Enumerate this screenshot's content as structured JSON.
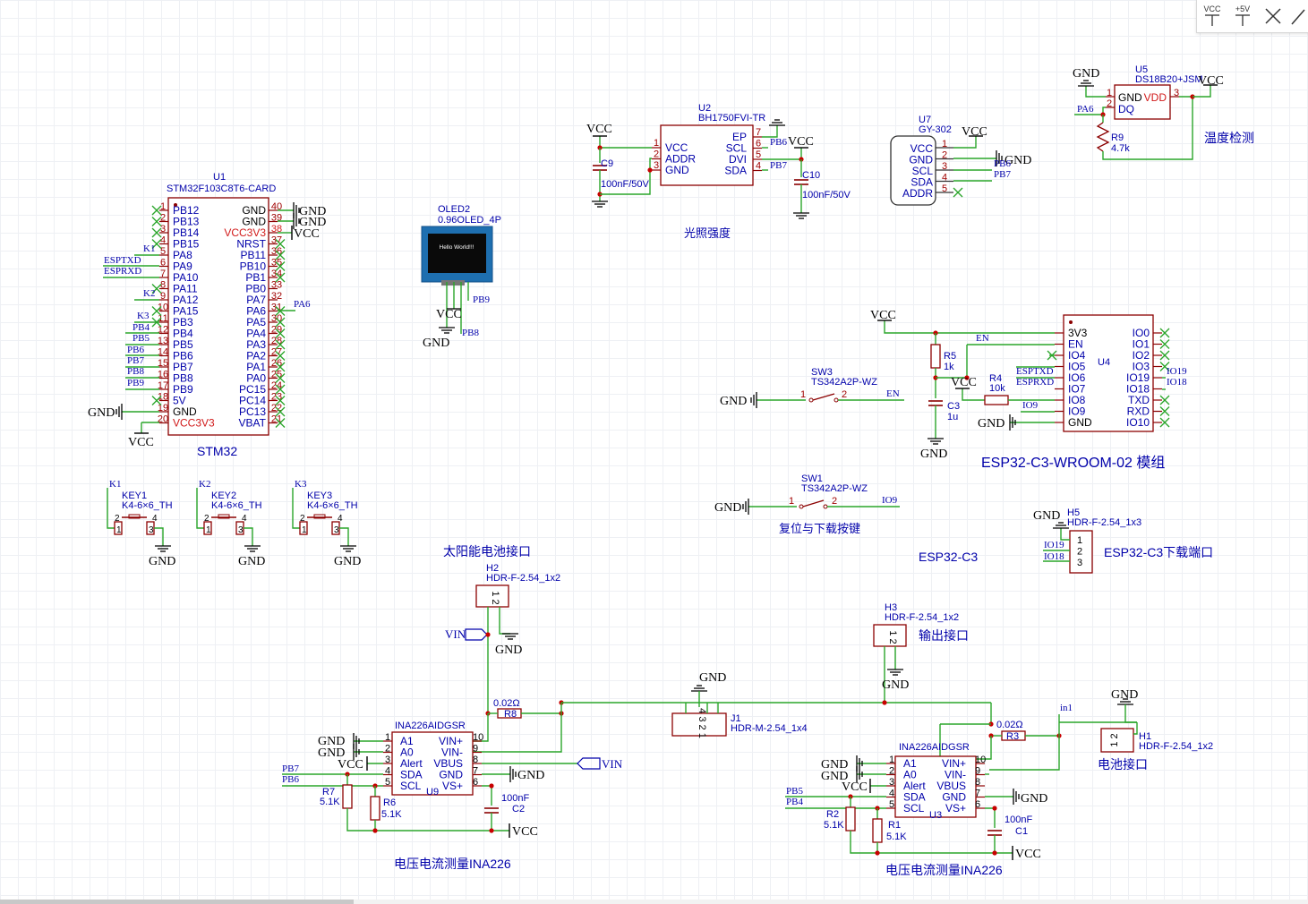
{
  "toolbar": {
    "vcc_label": "VCC",
    "plus5_label": "+5V"
  },
  "net": {
    "vcc": "VCC",
    "gnd": "GND",
    "vin": "VIN",
    "in1": "in1",
    "en": "EN",
    "io9": "IO9",
    "io18": "IO18",
    "io19": "IO19",
    "pa6": "PA6",
    "pb6": "PB6",
    "pb7": "PB7",
    "pb8": "PB8",
    "pb9": "PB9",
    "pb4": "PB4",
    "pb5": "PB5",
    "k1": "K1",
    "k2": "K2",
    "k3": "K3",
    "esptxd": "ESPTXD",
    "esprxd": "ESPRXD"
  },
  "u1": {
    "ref": "U1",
    "part": "STM32F103C8T6-CARD",
    "title": "STM32",
    "left_pins": [
      {
        "n": "1",
        "name": "PB12"
      },
      {
        "n": "2",
        "name": "PB13"
      },
      {
        "n": "3",
        "name": "PB14"
      },
      {
        "n": "4",
        "name": "PB15"
      },
      {
        "n": "5",
        "name": "PA8"
      },
      {
        "n": "6",
        "name": "PA9"
      },
      {
        "n": "7",
        "name": "PA10"
      },
      {
        "n": "8",
        "name": "PA11"
      },
      {
        "n": "9",
        "name": "PA12"
      },
      {
        "n": "10",
        "name": "PA15"
      },
      {
        "n": "11",
        "name": "PB3"
      },
      {
        "n": "12",
        "name": "PB4"
      },
      {
        "n": "13",
        "name": "PB5"
      },
      {
        "n": "14",
        "name": "PB6"
      },
      {
        "n": "15",
        "name": "PB7"
      },
      {
        "n": "16",
        "name": "PB8"
      },
      {
        "n": "17",
        "name": "PB9"
      },
      {
        "n": "18",
        "name": "5V"
      },
      {
        "n": "19",
        "name": "GND"
      },
      {
        "n": "20",
        "name": "VCC3V3"
      }
    ],
    "right_pins": [
      {
        "n": "40",
        "name": "GND"
      },
      {
        "n": "39",
        "name": "GND"
      },
      {
        "n": "38",
        "name": "VCC3V3"
      },
      {
        "n": "37",
        "name": "NRST"
      },
      {
        "n": "36",
        "name": "PB11"
      },
      {
        "n": "35",
        "name": "PB10"
      },
      {
        "n": "34",
        "name": "PB1"
      },
      {
        "n": "33",
        "name": "PB0"
      },
      {
        "n": "32",
        "name": "PA7"
      },
      {
        "n": "31",
        "name": "PA6"
      },
      {
        "n": "30",
        "name": "PA5"
      },
      {
        "n": "29",
        "name": "PA4"
      },
      {
        "n": "28",
        "name": "PA3"
      },
      {
        "n": "27",
        "name": "PA2"
      },
      {
        "n": "26",
        "name": "PA1"
      },
      {
        "n": "25",
        "name": "PA0"
      },
      {
        "n": "24",
        "name": "PC15"
      },
      {
        "n": "23",
        "name": "PC14"
      },
      {
        "n": "22",
        "name": "PC13"
      },
      {
        "n": "21",
        "name": "VBAT"
      }
    ],
    "left_nets": {
      "k1": "K1",
      "esptxd": "ESPTXD",
      "esprxd": "ESPRXD",
      "k2": "K2",
      "k3": "K3",
      "pb4": "PB4",
      "pb5": "PB5",
      "pb6": "PB6",
      "pb7": "PB7",
      "pb8": "PB8",
      "pb9": "PB9"
    }
  },
  "oled": {
    "ref": "OLED2",
    "part": "0.96OLED_4P",
    "screen_text": "Hello World!!!"
  },
  "u2": {
    "ref": "U2",
    "part": "BH1750FVI-TR",
    "title": "光照强度",
    "left_pins": [
      {
        "n": "1",
        "name": "VCC"
      },
      {
        "n": "2",
        "name": "ADDR"
      },
      {
        "n": "3",
        "name": "GND"
      }
    ],
    "right_pins": [
      {
        "n": "7",
        "name": "EP"
      },
      {
        "n": "6",
        "name": "SCL"
      },
      {
        "n": "5",
        "name": "DVI"
      },
      {
        "n": "4",
        "name": "SDA"
      }
    ]
  },
  "c9": {
    "ref": "C9",
    "value": "100nF/50V"
  },
  "c10": {
    "ref": "C10",
    "value": "100nF/50V"
  },
  "u7": {
    "ref": "U7",
    "part": "GY-302",
    "pins": [
      {
        "n": "1",
        "name": "VCC"
      },
      {
        "n": "2",
        "name": "GND"
      },
      {
        "n": "3",
        "name": "SCL"
      },
      {
        "n": "4",
        "name": "SDA"
      },
      {
        "n": "5",
        "name": "ADDR"
      }
    ]
  },
  "u5": {
    "ref": "U5",
    "part": "DS18B20+JSM",
    "title": "温度检测",
    "pins": [
      {
        "n": "1",
        "name": "GND"
      },
      {
        "n": "2",
        "name": "DQ"
      },
      {
        "n": "3",
        "name": "VDD"
      }
    ]
  },
  "r9": {
    "ref": "R9",
    "value": "4.7k"
  },
  "u4": {
    "ref": "U4",
    "title": "ESP32-C3-WROOM-02 模组",
    "left_pins": [
      "3V3",
      "EN",
      "IO4",
      "IO5",
      "IO6",
      "IO7",
      "IO8",
      "IO9",
      "GND"
    ],
    "right_pins": [
      "IO0",
      "IO1",
      "IO2",
      "IO3",
      "IO19",
      "IO18",
      "TXD",
      "RXD",
      "IO10"
    ]
  },
  "r5": {
    "ref": "R5",
    "value": "1k"
  },
  "r4": {
    "ref": "R4",
    "value": "10k"
  },
  "c3": {
    "ref": "C3",
    "value": "1u"
  },
  "sw3": {
    "ref": "SW3",
    "part": "TS342A2P-WZ",
    "p1": "1",
    "p2": "2"
  },
  "sw1": {
    "ref": "SW1",
    "part": "TS342A2P-WZ",
    "p1": "1",
    "p2": "2",
    "title": "复位与下载按键"
  },
  "esp_title": "ESP32-C3",
  "h5": {
    "ref": "H5",
    "part": "HDR-F-2.54_1x3",
    "title": "ESP32-C3下载端口",
    "pins": [
      "1",
      "2",
      "3"
    ]
  },
  "keys": [
    {
      "net": "K1",
      "ref": "KEY1",
      "part": "K4-6×6_TH"
    },
    {
      "net": "K2",
      "ref": "KEY2",
      "part": "K4-6×6_TH"
    },
    {
      "net": "K3",
      "ref": "KEY3",
      "part": "K4-6×6_TH"
    }
  ],
  "key_pins": [
    "2",
    "4",
    "1",
    "3"
  ],
  "h2": {
    "ref": "H2",
    "part": "HDR-F-2.54_1x2",
    "title": "太阳能电池接口"
  },
  "h3": {
    "ref": "H3",
    "part": "HDR-F-2.54_1x2",
    "title": "输出接口"
  },
  "h1": {
    "ref": "H1",
    "part": "HDR-F-2.54_1x2",
    "title": "电池接口"
  },
  "j1": {
    "ref": "J1",
    "part": "HDR-M-2.54_1x4",
    "pins": "4 3 2 1"
  },
  "hdr_pins": "1 2",
  "r8": {
    "ref": "R8",
    "value": "0.02Ω"
  },
  "r3": {
    "ref": "R3",
    "value": "0.02Ω"
  },
  "u9": {
    "ref": "U9",
    "part": "INA226AIDGSR",
    "title": "电压电流测量INA226",
    "left_pins": [
      {
        "n": "1",
        "name": "A1"
      },
      {
        "n": "2",
        "name": "A0"
      },
      {
        "n": "3",
        "name": "Alert"
      },
      {
        "n": "4",
        "name": "SDA"
      },
      {
        "n": "5",
        "name": "SCL"
      }
    ],
    "right_pins": [
      {
        "n": "10",
        "name": "VIN+"
      },
      {
        "n": "9",
        "name": "VIN-"
      },
      {
        "n": "8",
        "name": "VBUS"
      },
      {
        "n": "7",
        "name": "GND"
      },
      {
        "n": "6",
        "name": "VS+"
      }
    ]
  },
  "r7": {
    "ref": "R7",
    "value": "5.1K"
  },
  "r6": {
    "ref": "R6",
    "value": "5.1K"
  },
  "c2": {
    "ref": "C2",
    "value": "100nF"
  },
  "u3": {
    "ref": "U3",
    "part": "INA226AIDGSR",
    "title": "电压电流测量INA226"
  },
  "r2": {
    "ref": "R2",
    "value": "5.1K"
  },
  "r1": {
    "ref": "R1",
    "value": "5.1K"
  },
  "c1": {
    "ref": "C1",
    "value": "100nF"
  },
  "colors": {
    "wire": "#2aa52a",
    "body": "#8b0000",
    "pin": "#8b0000",
    "name": "#0000aa",
    "pinnum": "#a00000",
    "red": "#d11a1a",
    "netlabel": "#0000aa",
    "power": "#000000",
    "junction": "#c80000",
    "noconn": "#2aa52a"
  }
}
